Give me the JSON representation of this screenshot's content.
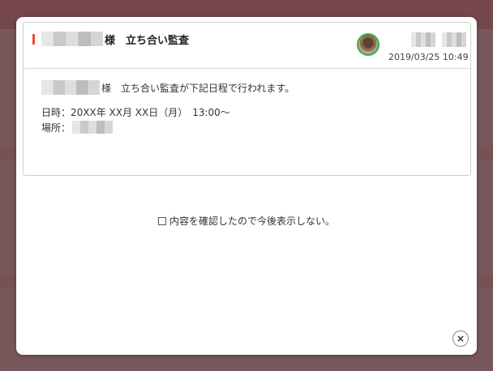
{
  "notice": {
    "title_suffix": "様　立ち合い監査",
    "timestamp": "2019/03/25 10:49",
    "message_suffix": "様　立ち合い監査が下記日程で行われます。",
    "datetime_line": "日時：20XX年 XX月 XX日（月）　13:00～",
    "place_label": "場所：",
    "accent_color": "#e8502f",
    "avatar_ring_color": "#2fb34a"
  },
  "confirm": {
    "label": "内容を確認したので今後表示しない。",
    "checked": false
  },
  "close_glyph": "×"
}
